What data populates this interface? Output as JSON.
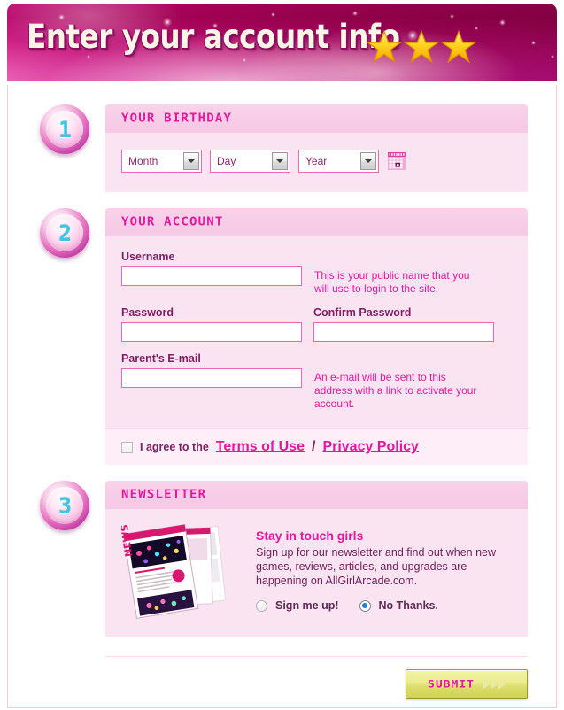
{
  "banner": {
    "title": "Enter your account info",
    "star_count": 3,
    "star_color": "#ffd21e",
    "bg_color": "#c8148e"
  },
  "theme": {
    "accent": "#e3189f",
    "panel_bg": "#fbe4f2",
    "panel_head_bg": "#f7cce6",
    "field_border": "#ec66b6",
    "label_color": "#7c1f63",
    "badge_number_color": "#3ac7e0",
    "submit_bg": "#dcdd6d"
  },
  "steps": [
    {
      "number": "1",
      "title": "Your Birthday",
      "selects": [
        {
          "name": "month",
          "value": "Month"
        },
        {
          "name": "day",
          "value": "Day"
        },
        {
          "name": "year",
          "value": "Year"
        }
      ],
      "calendar_icon": "calendar-icon"
    },
    {
      "number": "2",
      "title": "Your Account",
      "fields": [
        {
          "name": "username",
          "label": "Username",
          "value": "",
          "hint": "This is your public name that you will use to login to the site."
        },
        {
          "name": "password",
          "label": "Password",
          "value": "",
          "hint": ""
        },
        {
          "name": "confirm_password",
          "label": "Confirm Password",
          "value": "",
          "hint": ""
        },
        {
          "name": "parents_email",
          "label": "Parent's E-mail",
          "value": "",
          "hint": "An e-mail will be sent to this address with a link to activate your account."
        }
      ],
      "agree": {
        "checked": false,
        "prefix": "I agree to the",
        "terms_label": "Terms of Use",
        "separator": "/",
        "privacy_label": "Privacy Policy"
      }
    },
    {
      "number": "3",
      "title": "Newsletter",
      "newsletter": {
        "image_name": "newsletter-pages-thumbnail",
        "heading": "Stay in touch girls",
        "body": "Sign up for our newsletter and find out when new games, reviews, articles, and upgrades are happening on AllGirlArcade.com.",
        "options": [
          {
            "name": "sign-me-up",
            "label": "Sign me up!",
            "selected": false
          },
          {
            "name": "no-thanks",
            "label": "No Thanks.",
            "selected": true
          }
        ]
      }
    }
  ],
  "footer": {
    "submit_label": "SUBMIT",
    "chevron_count": 3
  }
}
